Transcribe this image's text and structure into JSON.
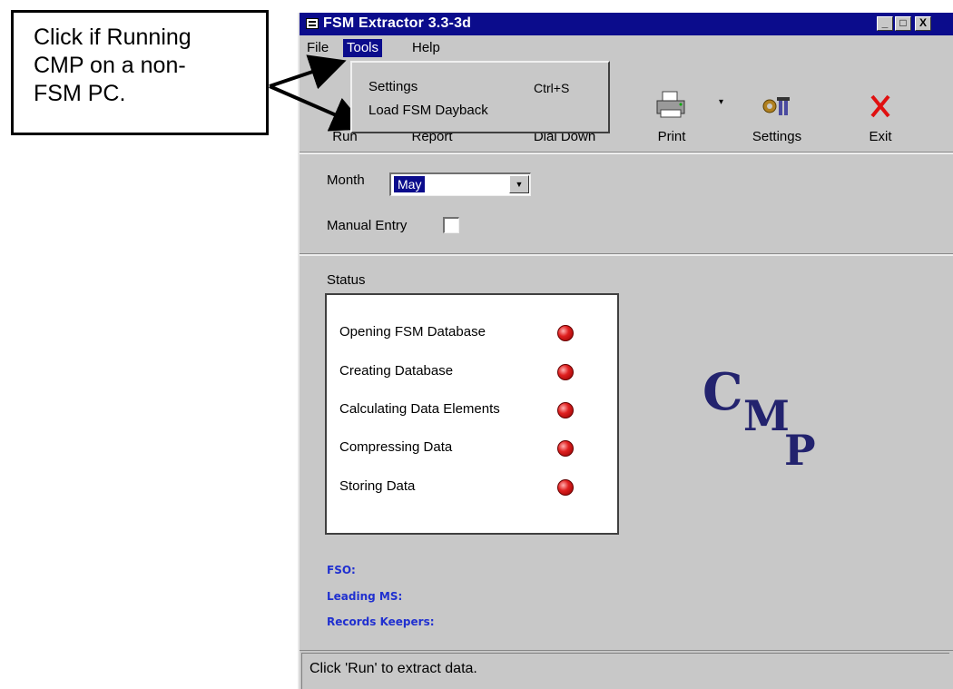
{
  "callout": {
    "line1": "Click if Running",
    "line2": "CMP on a non-",
    "line3": "FSM PC."
  },
  "window": {
    "title": "FSM Extractor 3.3-3d",
    "controls": [
      "_",
      "□",
      "X"
    ]
  },
  "menu": {
    "file": "File",
    "tools": "Tools",
    "help": "Help"
  },
  "tools_menu": {
    "settings": "Settings",
    "settings_shortcut": "Ctrl+S",
    "load": "Load FSM Dayback"
  },
  "toolbar": {
    "run": "Run",
    "report": "Report",
    "dial": "Dial Down",
    "print": "Print",
    "settings": "Settings",
    "exit": "Exit"
  },
  "form": {
    "month_label": "Month",
    "month_value": "May",
    "manual_label": "Manual Entry"
  },
  "status": {
    "label": "Status",
    "items": [
      "Opening FSM Database",
      "Creating Database",
      "Calculating Data Elements",
      "Compressing Data",
      "Storing Data"
    ]
  },
  "logo": {
    "c": "C",
    "m": "M",
    "p": "P"
  },
  "info": {
    "fso": "FSO:",
    "leading": "Leading MS:",
    "records": "Records Keepers:"
  },
  "statusbar": {
    "text": "Click 'Run' to extract data."
  },
  "colors": {
    "titlebar": "#0b0c8c",
    "window_bg": "#c8c8c8",
    "led": "#e02020",
    "logo": "#23236e",
    "info": "#2030d0"
  }
}
